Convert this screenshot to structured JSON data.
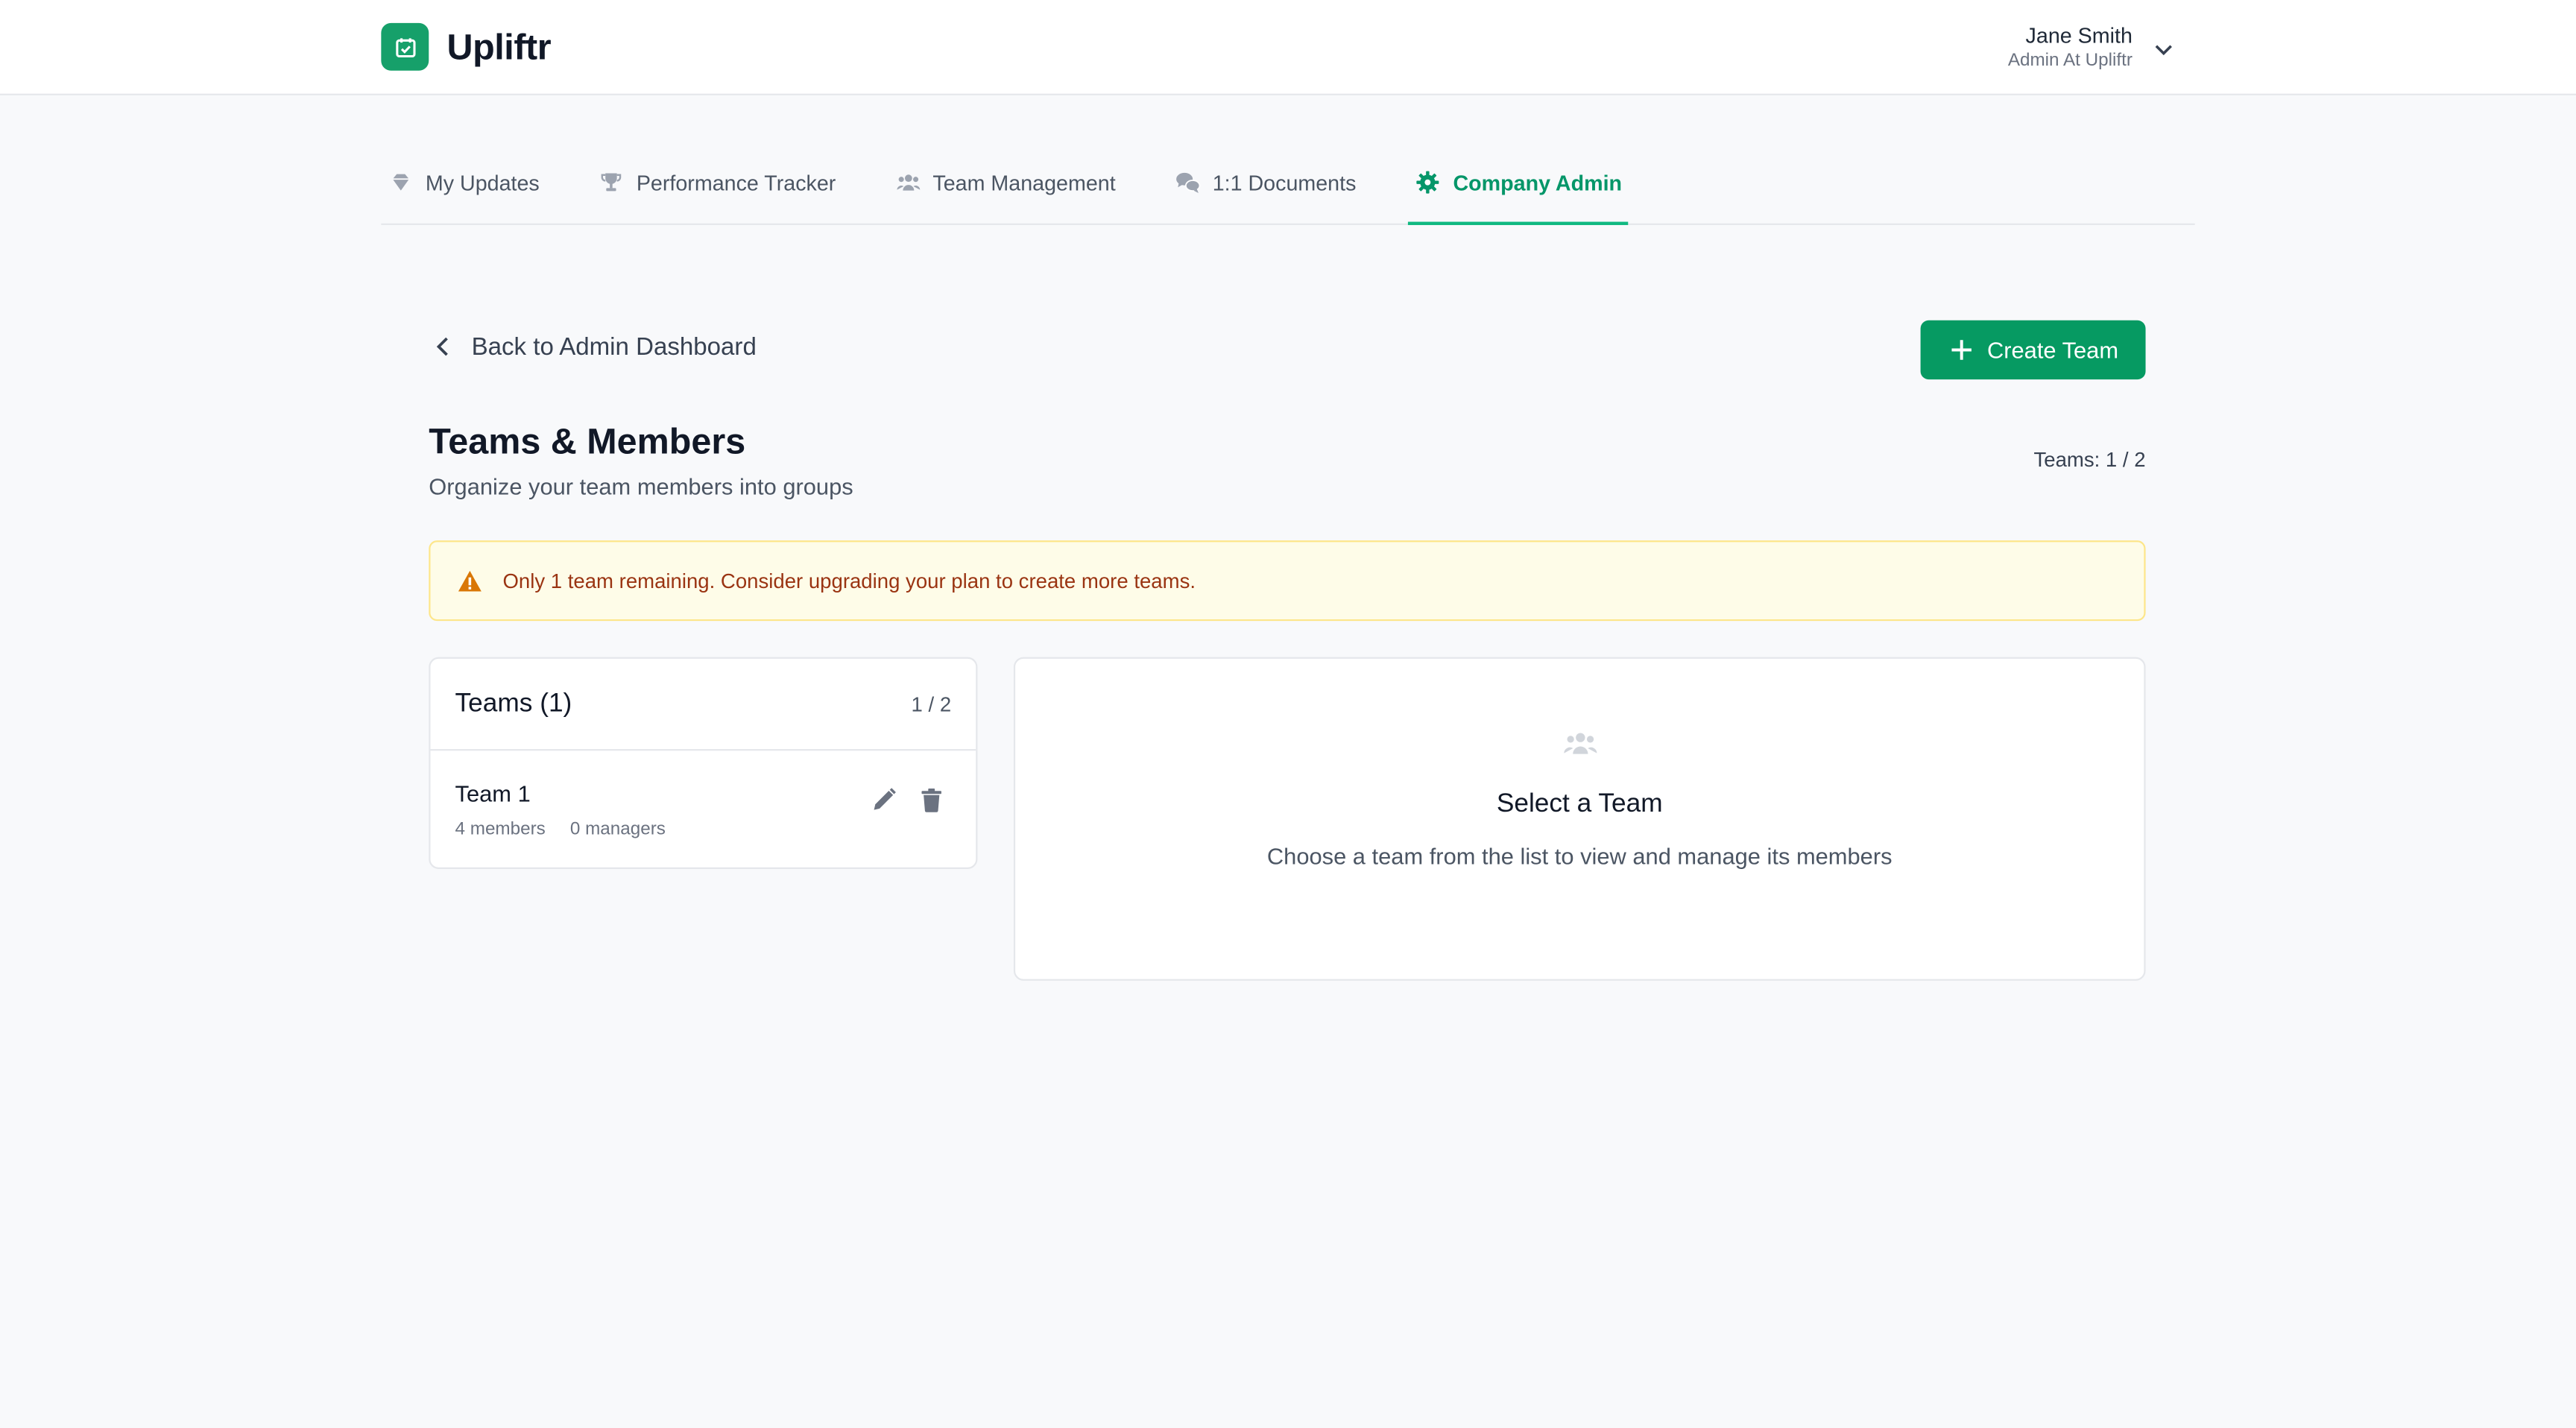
{
  "app": {
    "name": "Upliftr"
  },
  "user": {
    "name": "Jane Smith",
    "role": "Admin At Upliftr"
  },
  "tabs": [
    {
      "label": "My Updates",
      "icon": "gem-icon",
      "active": false
    },
    {
      "label": "Performance Tracker",
      "icon": "trophy-icon",
      "active": false
    },
    {
      "label": "Team Management",
      "icon": "users-icon",
      "active": false
    },
    {
      "label": "1:1 Documents",
      "icon": "chat-bubbles-icon",
      "active": false
    },
    {
      "label": "Company Admin",
      "icon": "gear-icon",
      "active": true
    }
  ],
  "nav": {
    "back_label": "Back to Admin Dashboard"
  },
  "actions": {
    "create_team_label": "Create Team"
  },
  "page": {
    "title": "Teams & Members",
    "subtitle": "Organize your team members into groups",
    "teams_count": "Teams: 1 / 2"
  },
  "warning": {
    "text": "Only 1 team remaining. Consider upgrading your plan to create more teams."
  },
  "teams_panel": {
    "title": "Teams (1)",
    "count": "1 / 2",
    "teams": [
      {
        "name": "Team 1",
        "members": "4 members",
        "managers": "0 managers"
      }
    ]
  },
  "detail": {
    "title": "Select a Team",
    "subtitle": "Choose a team from the list to view and manage its members"
  },
  "colors": {
    "brand": "#069a62",
    "active_tab": "#059669",
    "warning_bg": "#fefce8",
    "warning_border": "#fde68a",
    "warning_text": "#9a3412",
    "warning_icon": "#d97706"
  }
}
